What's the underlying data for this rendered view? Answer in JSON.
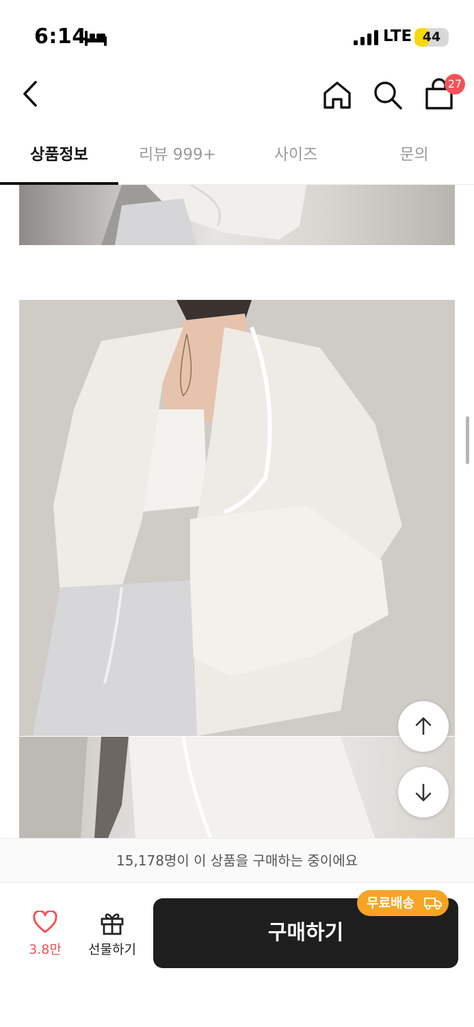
{
  "status_bar": {
    "time": "6:14",
    "network": "LTE",
    "battery_level": "44",
    "battery_fraction": 0.44,
    "sleep_icon": "bed-icon",
    "signal_icon": "cellular-signal-icon"
  },
  "nav": {
    "back_icon": "chevron-left-icon",
    "home_icon": "home-icon",
    "search_icon": "search-icon",
    "cart_icon": "shopping-bag-icon",
    "cart_count": "27"
  },
  "tabs": [
    {
      "label": "상품정보",
      "active": true
    },
    {
      "label": "리뷰 999+",
      "active": false
    },
    {
      "label": "사이즈",
      "active": false
    },
    {
      "label": "문의",
      "active": false
    }
  ],
  "floating": {
    "up_icon": "arrow-up-icon",
    "down_icon": "arrow-down-icon"
  },
  "notice": {
    "text": "15,178명이 이 상품을 구매하는 중이에요"
  },
  "bottom_bar": {
    "like_count": "3.8만",
    "gift_label": "선물하기",
    "buy_label": "구매하기",
    "free_shipping_label": "무료배송"
  },
  "colors": {
    "accent_red": "#f2535a",
    "buy_button": "#1e1e1e",
    "free_shipping": "#f7a425",
    "battery_yellow": "#f5d90a"
  }
}
